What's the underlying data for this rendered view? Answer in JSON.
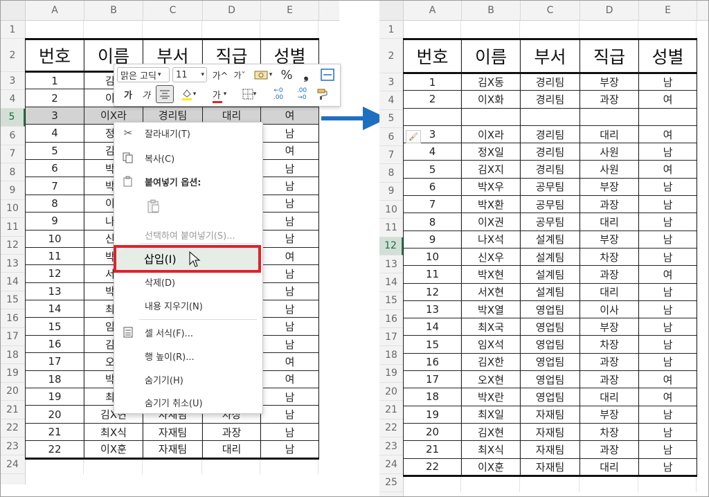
{
  "left": {
    "columns": [
      "A",
      "B",
      "C",
      "D",
      "E"
    ],
    "rows": [
      "1",
      "2",
      "3",
      "4",
      "5",
      "6",
      "7",
      "8",
      "9",
      "10",
      "11",
      "12",
      "13",
      "14",
      "15",
      "16",
      "17",
      "18",
      "19",
      "20",
      "21",
      "22",
      "23",
      "24"
    ],
    "selected_row": "5",
    "headers": [
      "번호",
      "이름",
      "부서",
      "직급",
      "성별"
    ],
    "records": [
      [
        "1",
        "김X",
        "",
        "",
        ""
      ],
      [
        "2",
        "이X",
        "",
        "",
        ""
      ],
      [
        "3",
        "이X라",
        "경리팀",
        "대리",
        "여"
      ],
      [
        "4",
        "정X",
        "",
        "",
        "남"
      ],
      [
        "5",
        "김X",
        "",
        "",
        "여"
      ],
      [
        "6",
        "박X",
        "",
        "",
        "남"
      ],
      [
        "7",
        "박X",
        "",
        "",
        "남"
      ],
      [
        "8",
        "이X",
        "",
        "",
        "남"
      ],
      [
        "9",
        "나X",
        "",
        "",
        "남"
      ],
      [
        "10",
        "신X",
        "",
        "",
        "남"
      ],
      [
        "11",
        "박X",
        "",
        "",
        "여"
      ],
      [
        "12",
        "서X",
        "",
        "",
        "남"
      ],
      [
        "13",
        "박X",
        "",
        "",
        "남"
      ],
      [
        "14",
        "최X",
        "",
        "",
        "남"
      ],
      [
        "15",
        "임X",
        "",
        "",
        "남"
      ],
      [
        "16",
        "김X",
        "",
        "",
        "남"
      ],
      [
        "17",
        "오X",
        "",
        "",
        "여"
      ],
      [
        "18",
        "박X",
        "",
        "",
        "여"
      ],
      [
        "19",
        "최X",
        "",
        "",
        "남"
      ],
      [
        "20",
        "김X현",
        "자재팀",
        "차장",
        "남"
      ],
      [
        "21",
        "최X식",
        "자재팀",
        "과장",
        "남"
      ],
      [
        "22",
        "이X훈",
        "자재팀",
        "대리",
        "남"
      ]
    ]
  },
  "mini_toolbar": {
    "font_name": "맑은 고딕",
    "font_size": "11",
    "grow_font": "가^",
    "shrink_font": "가ˇ",
    "percent": "%",
    "comma": "❟",
    "bold": "가",
    "italic": "가",
    "font_color": "가",
    "inc_decimal": "←0 .00",
    "dec_decimal": ".00 →0"
  },
  "context_menu": {
    "cut": "잘라내기(T)",
    "copy": "복사(C)",
    "paste_options": "붙여넣기 옵션:",
    "paste_special": "선택하여 붙여넣기(S)...",
    "insert": "삽입(I)",
    "delete": "삭제(D)",
    "clear_contents": "내용 지우기(N)",
    "format_cells": "셀 서식(F)...",
    "row_height": "행 높이(R)...",
    "hide": "숨기기(H)",
    "unhide": "숨기기 취소(U)"
  },
  "right": {
    "columns": [
      "A",
      "B",
      "C",
      "D",
      "E"
    ],
    "rows": [
      "1",
      "2",
      "3",
      "4",
      "5",
      "6",
      "7",
      "8",
      "9",
      "10",
      "11",
      "12",
      "13",
      "14",
      "15",
      "16",
      "17",
      "18",
      "19",
      "20",
      "21",
      "22",
      "23",
      "24",
      "25"
    ],
    "selected_row": "12",
    "headers": [
      "번호",
      "이름",
      "부서",
      "직급",
      "성별"
    ],
    "records": [
      [
        "1",
        "김X동",
        "경리팀",
        "부장",
        "남"
      ],
      [
        "2",
        "이X화",
        "경리팀",
        "과장",
        "여"
      ],
      [
        "",
        "",
        "",
        "",
        ""
      ],
      [
        "3",
        "이X라",
        "경리팀",
        "대리",
        "여"
      ],
      [
        "4",
        "정X일",
        "경리팀",
        "사원",
        "남"
      ],
      [
        "5",
        "김X지",
        "경리팀",
        "사원",
        "여"
      ],
      [
        "6",
        "박X우",
        "공무팀",
        "부장",
        "남"
      ],
      [
        "7",
        "박X환",
        "공무팀",
        "과장",
        "남"
      ],
      [
        "8",
        "이X권",
        "공무팀",
        "대리",
        "남"
      ],
      [
        "9",
        "나X석",
        "설계팀",
        "부장",
        "남"
      ],
      [
        "10",
        "신X우",
        "설계팀",
        "차장",
        "남"
      ],
      [
        "11",
        "박X현",
        "설계팀",
        "과장",
        "여"
      ],
      [
        "12",
        "서X현",
        "설계팀",
        "대리",
        "남"
      ],
      [
        "13",
        "박X열",
        "영업팀",
        "이사",
        "남"
      ],
      [
        "14",
        "최X국",
        "영업팀",
        "부장",
        "남"
      ],
      [
        "15",
        "임X석",
        "영업팀",
        "차장",
        "남"
      ],
      [
        "16",
        "김X한",
        "영업팀",
        "과장",
        "남"
      ],
      [
        "17",
        "오X현",
        "영업팀",
        "과장",
        "여"
      ],
      [
        "18",
        "박X란",
        "영업팀",
        "대리",
        "여"
      ],
      [
        "19",
        "최X일",
        "자재팀",
        "부장",
        "남"
      ],
      [
        "20",
        "김X현",
        "자재팀",
        "차장",
        "남"
      ],
      [
        "21",
        "최X식",
        "자재팀",
        "과장",
        "남"
      ],
      [
        "22",
        "이X훈",
        "자재팀",
        "대리",
        "남"
      ]
    ]
  },
  "colors": {
    "arrow": "#1f6fc1",
    "highlight_border": "#e0212a",
    "excel_green": "#1e7a45"
  }
}
